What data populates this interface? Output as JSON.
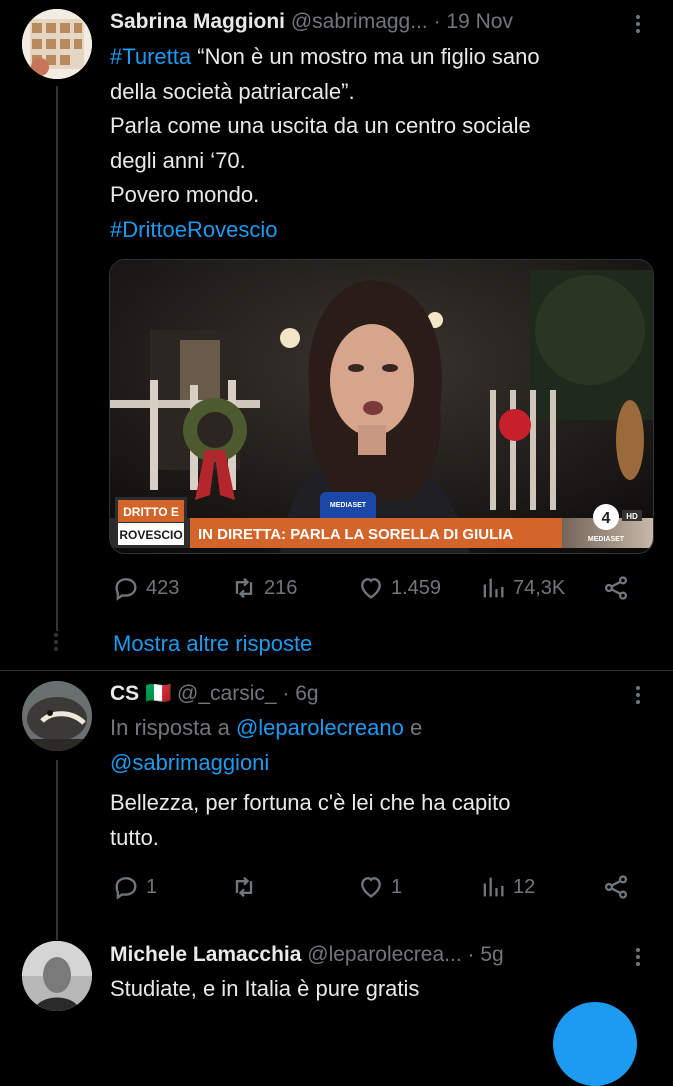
{
  "tweet1": {
    "display_name": "Sabrina Maggioni",
    "handle": "@sabrimagg...",
    "time": "· 19 Nov",
    "hashtag": "#Turetta",
    "text_l1": " “Non è un mostro ma un figlio sano",
    "text_l2": "della società patriarcale”.",
    "text_l3": "Parla come una uscita da un centro sociale",
    "text_l4": "degli anni ‘70.",
    "text_l5": "Povero mondo.",
    "hashtag2": "#DrittoeRovescio",
    "media": {
      "logo_line1": "DRITTO E",
      "logo_line2": "ROVESCIO",
      "banner": "IN DIRETTA: PARLA LA SORELLA DI GIULIA",
      "channel": "4",
      "channel_tag": "HD",
      "channel_name": "MEDIASET",
      "mic_label": "MEDIASET"
    },
    "stats": {
      "replies": "423",
      "retweets": "216",
      "likes": "1.459",
      "views": "74,3K"
    }
  },
  "show_more": "Mostra altre risposte",
  "tweet2": {
    "display_name": "CS",
    "flag": "🇮🇹",
    "handle": "@_carsic_",
    "time": "· 6g",
    "reply_prefix": "In risposta a ",
    "reply_to_1": "@leparolecreano",
    "reply_conj": " e",
    "reply_to_2": "@sabrimaggioni",
    "text_l1": "Bellezza, per fortuna c'è lei che ha capito",
    "text_l2": "tutto.",
    "stats": {
      "replies": "1",
      "retweets": "",
      "likes": "1",
      "views": "12"
    }
  },
  "tweet3": {
    "display_name": "Michele Lamacchia",
    "handle": "@leparolecrea...",
    "time": "· 5g",
    "text_l1": "Studiate, e in Italia è pure gratis"
  },
  "colors": {
    "accent": "#1d9bf0",
    "muted": "#71767b",
    "background": "#000000"
  },
  "icons": [
    "reply-icon",
    "retweet-icon",
    "like-icon",
    "views-icon",
    "share-icon",
    "more-icon"
  ]
}
